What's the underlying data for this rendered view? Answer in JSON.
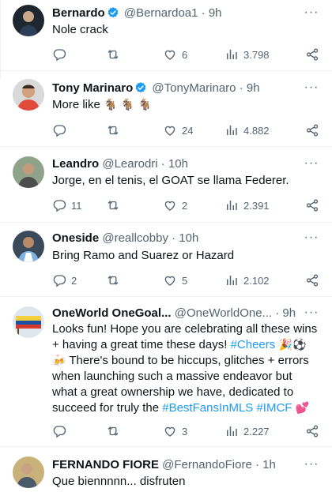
{
  "tweets": [
    {
      "name": "Bernardo",
      "verified": true,
      "handle": "@Bernardoa1",
      "time": "· 9h",
      "text": "Nole crack",
      "reply_count": "",
      "retweet_count": "",
      "like_count": "6",
      "view_count": "3.798"
    },
    {
      "name": "Tony Marinaro",
      "verified": true,
      "handle": "@TonyMarinaro",
      "time": "· 9h",
      "text": "More like",
      "emoji": "🐐 🐐 🐐",
      "reply_count": "",
      "retweet_count": "",
      "like_count": "24",
      "view_count": "4.882"
    },
    {
      "name": "Leandro",
      "verified": false,
      "handle": "@Learodri",
      "time": "· 10h",
      "text": "Jorge, en el tenis, el GOAT se llama Federer.",
      "reply_count": "11",
      "retweet_count": "",
      "like_count": "2",
      "view_count": "2.391"
    },
    {
      "name": "Oneside",
      "verified": false,
      "handle": "@reallcobby",
      "time": "· 10h",
      "text": "Bring Ramo and Suarez or Hazard",
      "reply_count": "2",
      "retweet_count": "",
      "like_count": "5",
      "view_count": "2.102"
    },
    {
      "name": "OneWorld OneGoal...",
      "verified": false,
      "handle": "@OneWorldOne...",
      "time": "· 9h",
      "text_part1": "Looks fun! Hope you are celebrating all these wins + having a great time these days! ",
      "hashtag1": "#Cheers",
      "emoji1": " 🎉⚽🍻",
      "text_part2": " There's bound to be hiccups, glitches + errors when launching such a massive endeavor but what a great ownership we have, dedicated to succeed for truly the ",
      "hashtag2": "#BestFansInMLS",
      "hashtag3": "#IMCF",
      "emoji2": " 💕",
      "reply_count": "",
      "retweet_count": "",
      "like_count": "3",
      "view_count": "2.227"
    },
    {
      "name": "FERNANDO FIORE",
      "verified": false,
      "handle": "@FernandoFiore",
      "time": "· 1h",
      "text": "Que biennnnn... disfruten"
    }
  ],
  "icons": {
    "reply": "reply-icon",
    "retweet": "retweet-icon",
    "like": "heart-icon",
    "views": "views-icon",
    "share": "share-icon",
    "more": "more-icon",
    "verified": "verified-badge-icon"
  },
  "colors": {
    "text": "#0f1419",
    "secondary": "#536471",
    "accent": "#1d9bf0",
    "divider": "#eff3f4"
  }
}
